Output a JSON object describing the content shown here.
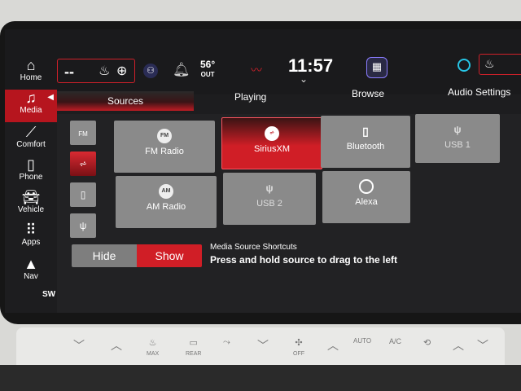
{
  "status_bar": {
    "left_seat_value": "--",
    "temperature": "56°",
    "temperature_label": "OUT",
    "clock": "11:57"
  },
  "tabs": {
    "sources": "Sources",
    "playing": "Playing",
    "browse": "Browse",
    "audio_settings": "Audio Settings"
  },
  "sidebar": {
    "items": [
      {
        "label": "Home",
        "icon": "home-icon"
      },
      {
        "label": "Media",
        "icon": "music-note-icon"
      },
      {
        "label": "Comfort",
        "icon": "seat-icon"
      },
      {
        "label": "Phone",
        "icon": "phone-icon"
      },
      {
        "label": "Vehicle",
        "icon": "car-icon"
      },
      {
        "label": "Apps",
        "icon": "apps-grid-icon"
      },
      {
        "label": "Nav",
        "icon": "navigation-arrow-icon"
      }
    ],
    "compass": "SW"
  },
  "source_shortcuts": [
    "FM",
    "SiriusXM",
    "Bluetooth",
    "USB"
  ],
  "sources": {
    "fm_radio": "FM Radio",
    "siriusxm": "SiriusXM",
    "bluetooth": "Bluetooth",
    "usb1": "USB 1",
    "am_radio": "AM Radio",
    "usb2": "USB 2",
    "alexa": "Alexa"
  },
  "tile_badges": {
    "fm": "FM",
    "am": "AM"
  },
  "shortcuts_toggle": {
    "hide": "Hide",
    "show": "Show",
    "selected": "Show"
  },
  "shortcuts_info": {
    "title": "Media Source Shortcuts",
    "description": "Press and hold source to drag to the left"
  },
  "climate": {
    "max": "MAX",
    "rear": "REAR",
    "off": "OFF",
    "auto": "AUTO",
    "ac": "A/C"
  },
  "colors": {
    "accent": "#d01e26",
    "screen_bg": "#1d1d1f",
    "tile": "#8a8a8a"
  }
}
